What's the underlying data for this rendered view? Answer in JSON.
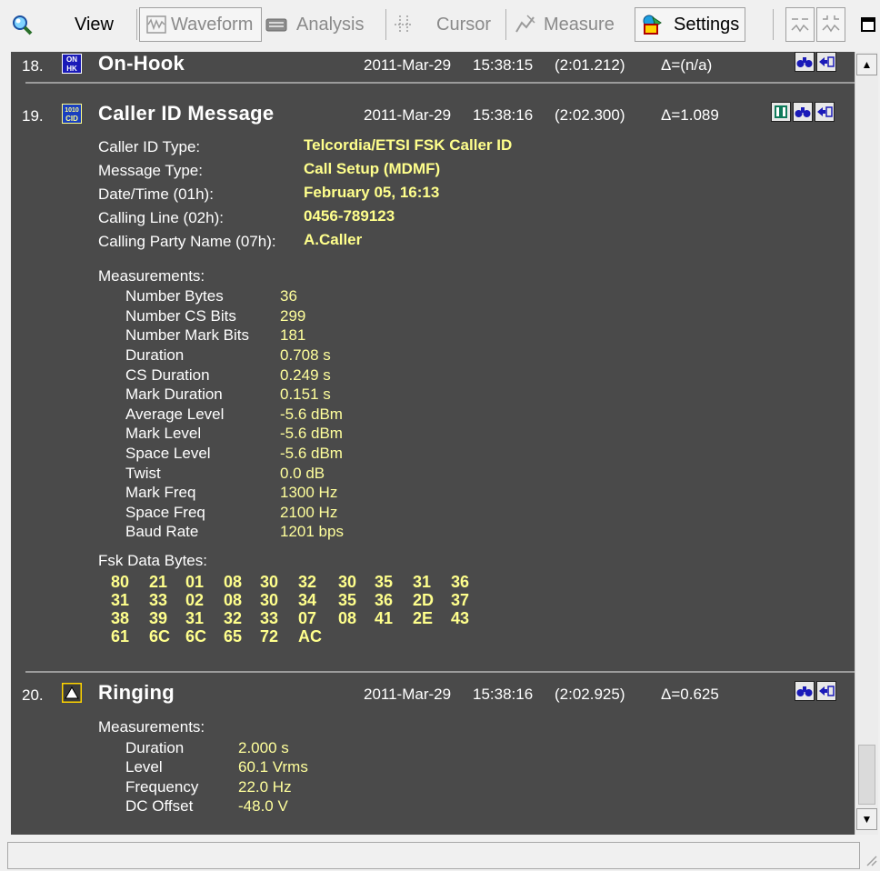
{
  "toolbar": {
    "view": "View",
    "waveform": "Waveform",
    "analysis": "Analysis",
    "cursor": "Cursor",
    "measure": "Measure",
    "settings": "Settings"
  },
  "entries": [
    {
      "num": "18.",
      "icon_text": "ON HK",
      "title": "On-Hook",
      "date": "2011-Mar-29",
      "time": "15:38:15",
      "rel": "(2:01.212)",
      "delta": "Δ=(n/a)"
    },
    {
      "num": "19.",
      "icon_text": "1010 CID",
      "title": "Caller ID Message",
      "date": "2011-Mar-29",
      "time": "15:38:16",
      "rel": "(2:02.300)",
      "delta": "Δ=1.089",
      "fields": [
        {
          "label": "Caller ID Type:",
          "value": "Telcordia/ETSI FSK Caller ID"
        },
        {
          "label": "Message Type:",
          "value": "Call Setup (MDMF)"
        },
        {
          "label": "Date/Time (01h):",
          "value": "February 05, 16:13"
        },
        {
          "label": "Calling Line (02h):",
          "value": "0456-789123"
        },
        {
          "label": "Calling Party Name (07h):",
          "value": "A.Caller"
        }
      ],
      "measurements_label": "Measurements:",
      "measurements": [
        {
          "label": "Number Bytes",
          "value": "36"
        },
        {
          "label": "Number CS Bits",
          "value": "299"
        },
        {
          "label": "Number Mark Bits",
          "value": "181"
        },
        {
          "label": "Duration",
          "value": "0.708  s"
        },
        {
          "label": "CS Duration",
          "value": "0.249  s"
        },
        {
          "label": "Mark Duration",
          "value": "0.151  s"
        },
        {
          "label": "Average Level",
          "value": "-5.6  dBm"
        },
        {
          "label": "Mark Level",
          "value": "-5.6  dBm"
        },
        {
          "label": "Space Level",
          "value": "-5.6  dBm"
        },
        {
          "label": "Twist",
          "value": "0.0  dB"
        },
        {
          "label": "Mark Freq",
          "value": "1300  Hz"
        },
        {
          "label": "Space Freq",
          "value": "2100  Hz"
        },
        {
          "label": "Baud Rate",
          "value": "1201  bps"
        }
      ],
      "fsk_label": "Fsk Data Bytes:",
      "fsk_rows": [
        [
          "80",
          "21",
          "01",
          "08",
          "30",
          "32",
          "30",
          "35",
          "31",
          "36"
        ],
        [
          "31",
          "33",
          "02",
          "08",
          "30",
          "34",
          "35",
          "36",
          "2D",
          "37"
        ],
        [
          "38",
          "39",
          "31",
          "32",
          "33",
          "07",
          "08",
          "41",
          "2E",
          "43"
        ],
        [
          "61",
          "6C",
          "6C",
          "65",
          "72",
          "AC"
        ]
      ]
    },
    {
      "num": "20.",
      "icon_text": "▲",
      "title": "Ringing",
      "date": "2011-Mar-29",
      "time": "15:38:16",
      "rel": "(2:02.925)",
      "delta": "Δ=0.625",
      "measurements_label": "Measurements:",
      "measurements": [
        {
          "label": "Duration",
          "value": "2.000  s"
        },
        {
          "label": "Level",
          "value": "60.1  Vrms"
        },
        {
          "label": "Frequency",
          "value": "22.0  Hz"
        },
        {
          "label": "DC Offset",
          "value": "-48.0  V"
        }
      ]
    }
  ],
  "colors": {
    "log_background": "#4a4a4a",
    "value_yellow": "#ffff8c",
    "label_white": "#ffffff"
  }
}
